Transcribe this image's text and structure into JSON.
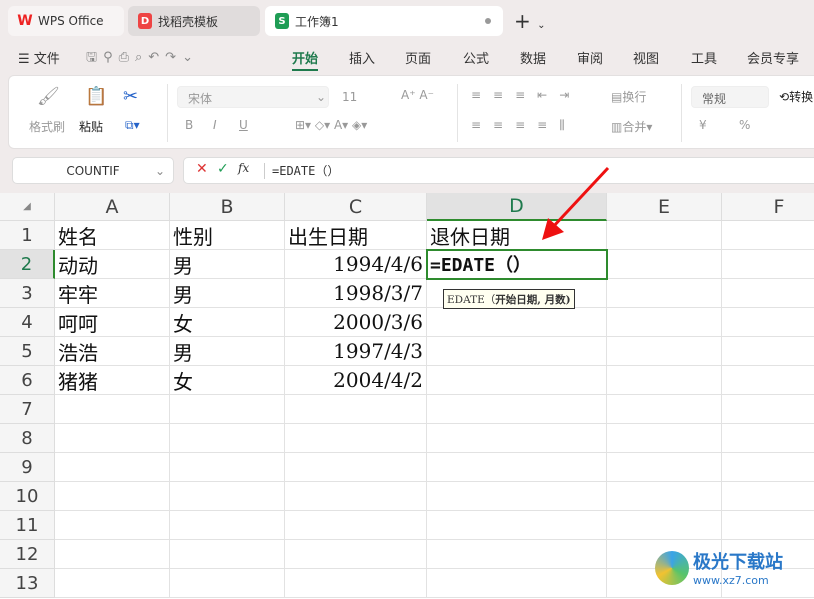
{
  "tabs": [
    {
      "label": "WPS Office",
      "icon": "wps-logo-icon"
    },
    {
      "label": "找稻壳模板",
      "icon": "docer-icon"
    },
    {
      "label": "工作簿1",
      "icon": "sheet-icon",
      "active": true
    }
  ],
  "menu": {
    "file": "文件",
    "items": [
      "开始",
      "插入",
      "页面",
      "公式",
      "数据",
      "审阅",
      "视图",
      "工具",
      "会员专享"
    ],
    "active": "开始"
  },
  "ribbon": {
    "format_painter": "格式刷",
    "paste": "粘贴",
    "font": "宋体",
    "font_size": "11",
    "wrap": "换行",
    "merge": "合并",
    "number_format": "常规",
    "convert": "转换",
    "bold": "B",
    "italic": "I",
    "underline": "U",
    "currency": "¥",
    "percent": "%"
  },
  "formula": {
    "name_box": "COUNTIF",
    "content": "=EDATE（）",
    "fx": "fx"
  },
  "columns": [
    "A",
    "B",
    "C",
    "D",
    "E",
    "F"
  ],
  "rows": [
    "1",
    "2",
    "3",
    "4",
    "5",
    "6",
    "7",
    "8",
    "9",
    "10",
    "11",
    "12",
    "13"
  ],
  "cells": [
    [
      "姓名",
      "性别",
      "出生日期",
      "退休日期"
    ],
    [
      "动动",
      "男",
      "1994/4/6",
      "=EDATE（）"
    ],
    [
      "牢牢",
      "男",
      "1998/3/7",
      ""
    ],
    [
      "呵呵",
      "女",
      "2000/3/6",
      ""
    ],
    [
      "浩浩",
      "男",
      "1997/4/3",
      ""
    ],
    [
      "猪猪",
      "女",
      "2004/4/2",
      ""
    ]
  ],
  "tooltip": {
    "func": "EDATE（",
    "args": "开始日期, 月数)"
  },
  "watermark": {
    "name": "极光下载站",
    "url": "www.xz7.com"
  },
  "colors": {
    "accent": "#1f7a4d",
    "selection": "#2e8b2e",
    "arrow": "#e11"
  }
}
